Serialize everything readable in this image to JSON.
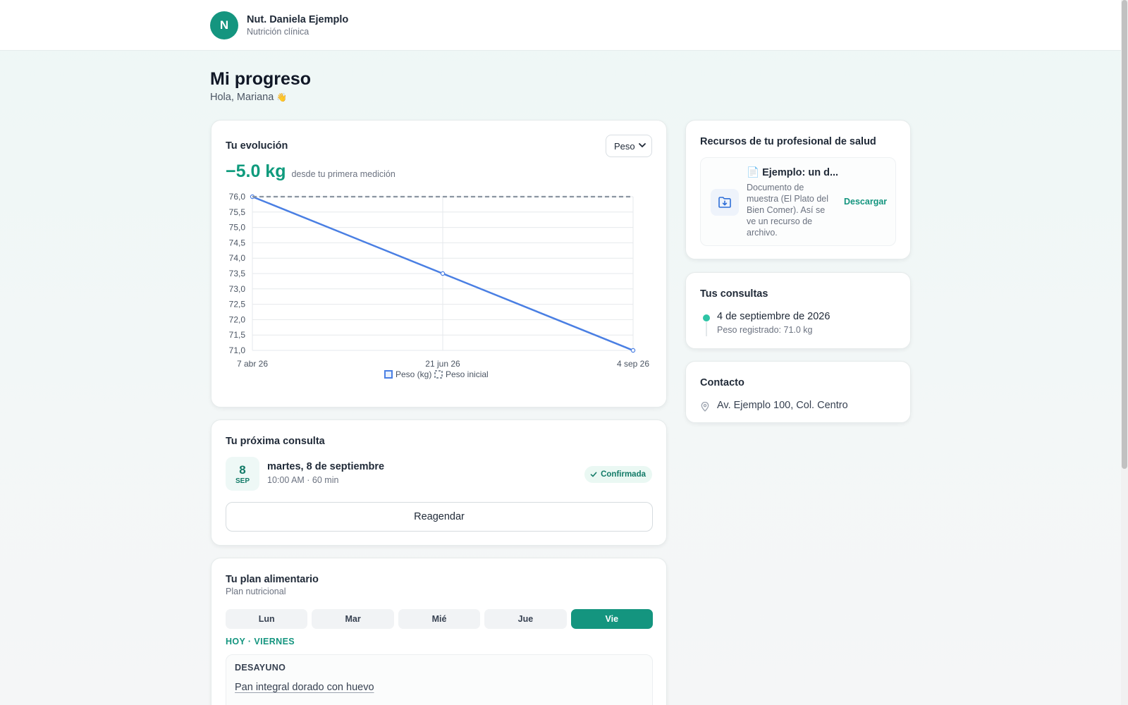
{
  "header": {
    "avatar_initial": "N",
    "professional_name": "Nut. Daniela Ejemplo",
    "specialty": "Nutrición clínica"
  },
  "page": {
    "title": "Mi progreso",
    "greeting": "Hola, Mariana",
    "greeting_emoji": "👋"
  },
  "evolution": {
    "title": "Tu evolución",
    "metric_selected": "Peso",
    "delta_value": "−5.0 kg",
    "delta_caption": "desde tu primera medición"
  },
  "chart_data": {
    "type": "line",
    "x": [
      "7 abr 26",
      "21 jun 26",
      "4 sep 26"
    ],
    "series": [
      {
        "name": "Peso (kg)",
        "values": [
          76.0,
          73.5,
          71.0
        ],
        "color": "#4a7fe3",
        "style": "solid"
      },
      {
        "name": "Peso inicial",
        "values": [
          76.0,
          76.0,
          76.0
        ],
        "color": "#8b95a1",
        "style": "dashed"
      }
    ],
    "ylim": [
      71.0,
      76.0
    ],
    "yticks": [
      "76,0",
      "75,5",
      "75,0",
      "74,5",
      "74,0",
      "73,5",
      "73,0",
      "72,5",
      "72,0",
      "71,5",
      "71,0"
    ],
    "legend": "bottom",
    "grid": true
  },
  "next_appointment": {
    "title": "Tu próxima consulta",
    "day_num": "8",
    "month_abbr": "SEP",
    "date_text": "martes, 8 de septiembre",
    "time_text": "10:00 AM · 60 min",
    "status": "Confirmada",
    "reschedule_label": "Reagendar"
  },
  "meal_plan": {
    "title": "Tu plan alimentario",
    "subtitle": "Plan nutricional",
    "days": [
      "Lun",
      "Mar",
      "Mié",
      "Jue",
      "Vie"
    ],
    "active_day": "Vie",
    "today_label": "HOY · VIERNES",
    "meal_name": "DESAYUNO",
    "meal_item": "Pan integral dorado con huevo"
  },
  "resources": {
    "title": "Recursos de tu profesional de salud",
    "item_emoji": "📄",
    "item_title": "Ejemplo: un d...",
    "item_desc": "Documento de muestra (El Plato del Bien Comer). Así se ve un recurso de archivo.",
    "download_label": "Descargar"
  },
  "consultations": {
    "title": "Tus consultas",
    "entry_date": "4 de septiembre de 2026",
    "entry_weight": "Peso registrado: 71.0 kg"
  },
  "contact": {
    "title": "Contacto",
    "address": "Av. Ejemplo 100, Col. Centro"
  },
  "colors": {
    "brand": "#14957f",
    "line": "#4a7fe3",
    "dashed": "#8b95a1"
  }
}
